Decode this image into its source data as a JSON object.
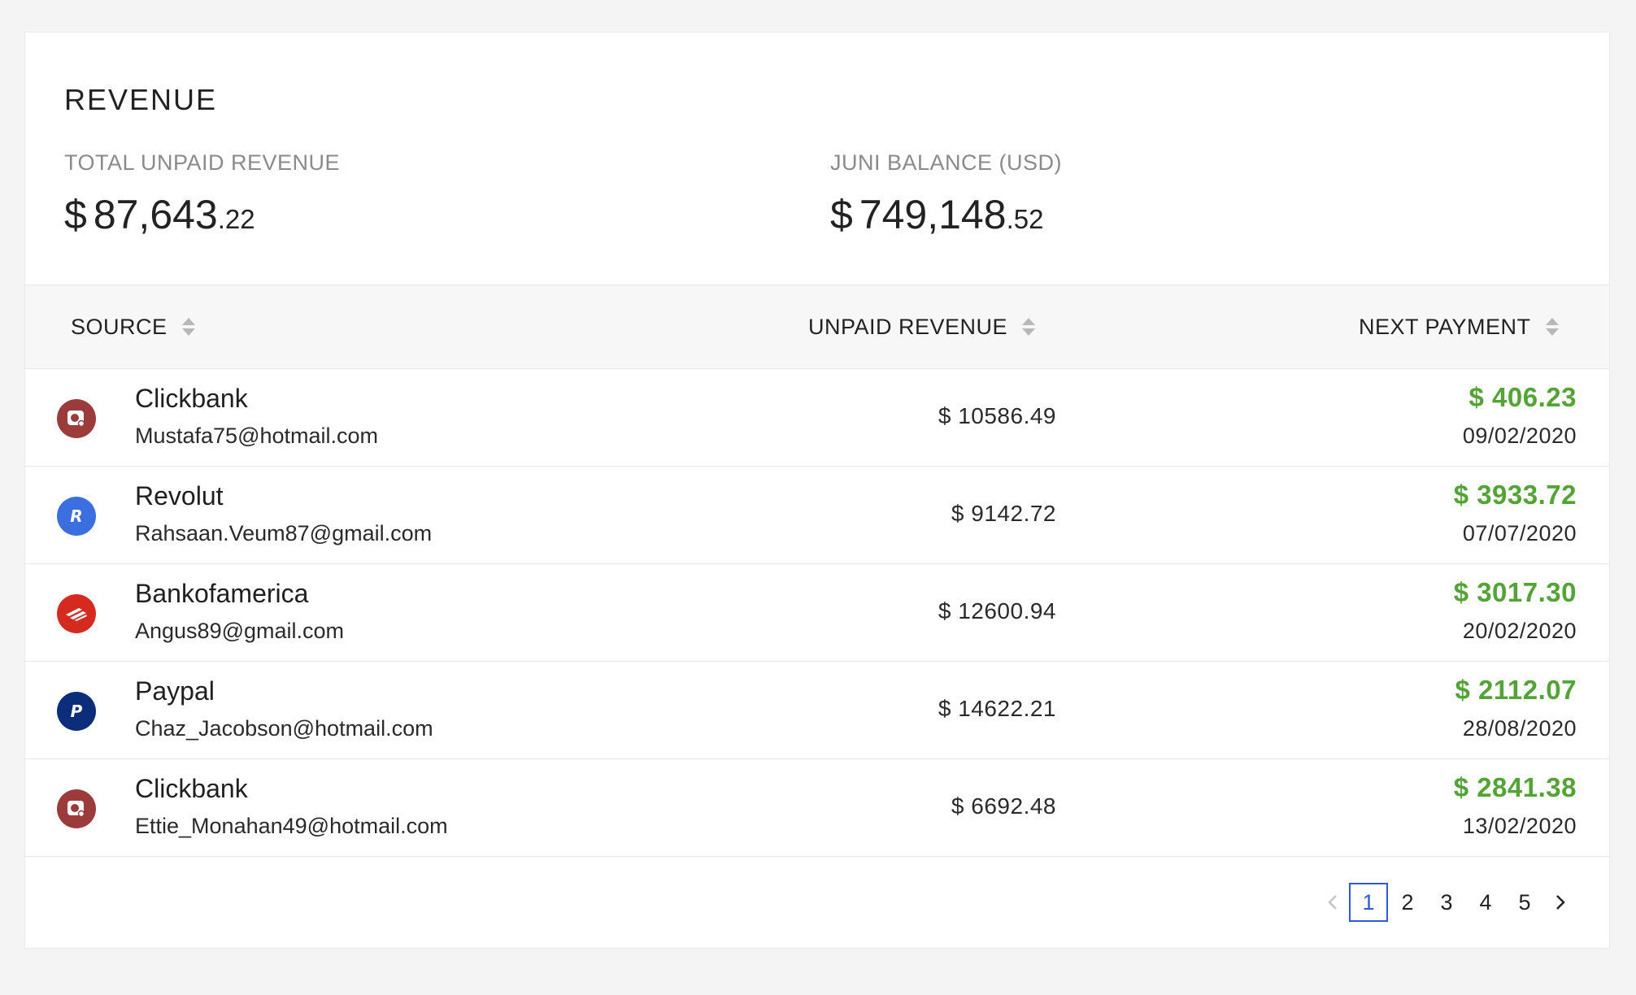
{
  "revenue": {
    "title": "REVENUE",
    "total_unpaid": {
      "label": "TOTAL UNPAID REVENUE",
      "currency": "$",
      "whole": "87,643",
      "cents": ".22"
    },
    "balance": {
      "label": "JUNI BALANCE (USD)",
      "currency": "$",
      "whole": "749,148",
      "cents": ".52"
    }
  },
  "table": {
    "headers": {
      "source": "SOURCE",
      "unpaid": "UNPAID REVENUE",
      "next_payment": "NEXT PAYMENT"
    },
    "rows": [
      {
        "source": "Clickbank",
        "email": "Mustafa75@hotmail.com",
        "unpaid": "$ 10586.49",
        "amount": "$ 406.23",
        "date": "09/02/2020",
        "logo": "clickbank-logo"
      },
      {
        "source": "Revolut",
        "email": "Rahsaan.Veum87@gmail.com",
        "unpaid": "$ 9142.72",
        "amount": "$ 3933.72",
        "date": "07/07/2020",
        "logo": "revolut-logo"
      },
      {
        "source": "Bankofamerica",
        "email": "Angus89@gmail.com",
        "unpaid": "$ 12600.94",
        "amount": "$ 3017.30",
        "date": "20/02/2020",
        "logo": "bankofamerica-logo"
      },
      {
        "source": "Paypal",
        "email": "Chaz_Jacobson@hotmail.com",
        "unpaid": "$ 14622.21",
        "amount": "$ 2112.07",
        "date": "28/08/2020",
        "logo": "paypal-logo"
      },
      {
        "source": "Clickbank",
        "email": "Ettie_Monahan49@hotmail.com",
        "unpaid": "$ 6692.48",
        "amount": "$ 2841.38",
        "date": "13/02/2020",
        "logo": "clickbank-logo"
      }
    ]
  },
  "pagination": {
    "pages": [
      "1",
      "2",
      "3",
      "4",
      "5"
    ],
    "current": "1"
  },
  "colors": {
    "positive": "#53a336",
    "active_page": "#2e5bd8",
    "clickbank": "#9b3b3b",
    "revolut": "#3b6fe0",
    "bankofamerica": "#d42a1f",
    "paypal": "#0c2d7a"
  }
}
